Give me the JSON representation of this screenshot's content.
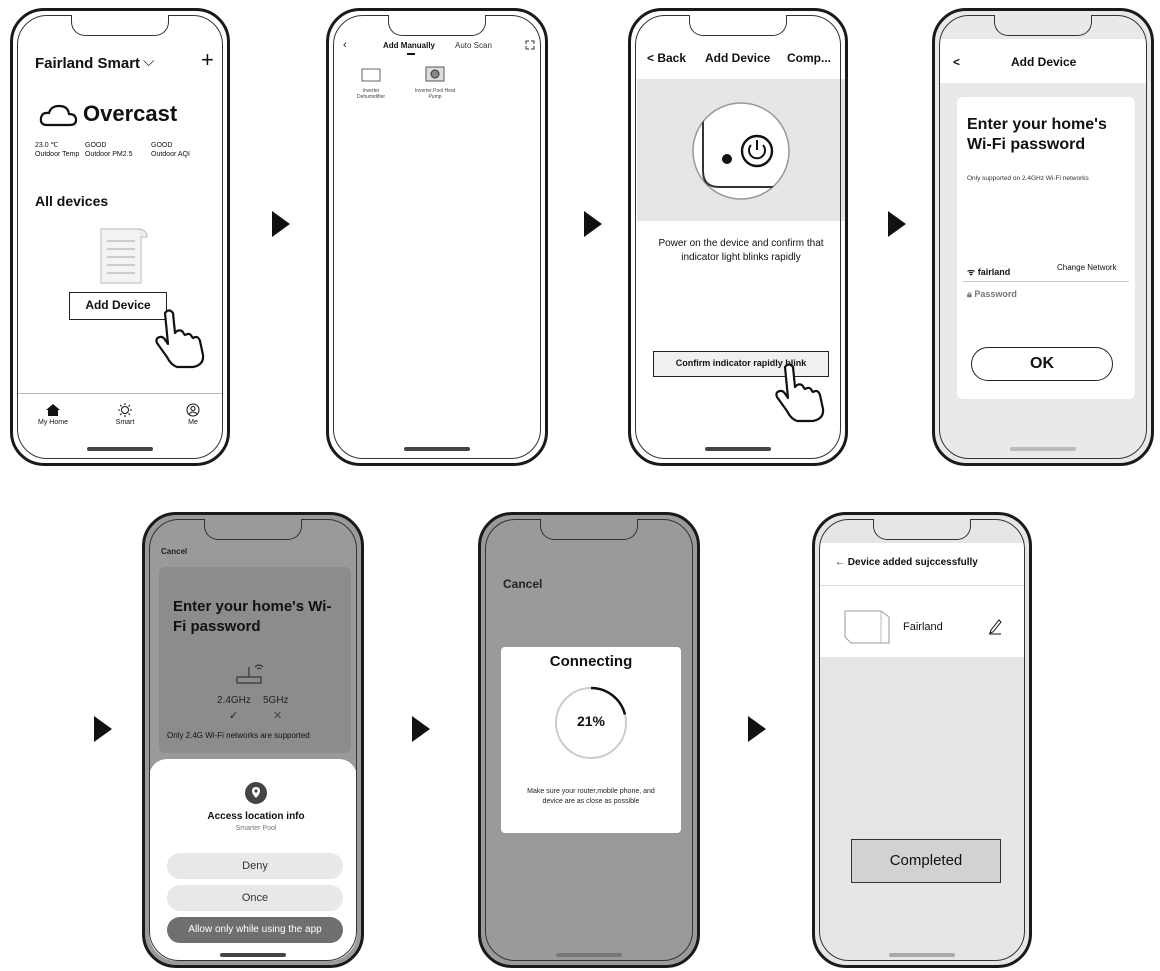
{
  "screen1": {
    "home_name": "Fairland Smart",
    "dropdown_glyph": "⌵",
    "add_glyph": "+",
    "weather": "Overcast",
    "stats": [
      {
        "value": "23.0 ℃",
        "label": "Outdoor Temp"
      },
      {
        "value": "GOOD",
        "label": "Outdoor PM2.5"
      },
      {
        "value": "GOOD",
        "label": "Outdoor AQI"
      }
    ],
    "section_title": "All devices",
    "add_device_button": "Add Device",
    "nav": [
      {
        "label": "My Home",
        "icon": "home-icon"
      },
      {
        "label": "Smart",
        "icon": "sun-icon"
      },
      {
        "label": "Me",
        "icon": "user-icon"
      }
    ]
  },
  "screen2": {
    "tab_manual": "Add Manually",
    "tab_scan": "Auto Scan",
    "devices": [
      {
        "label": "Inverter Dehumidifier"
      },
      {
        "label": "Inverter Pool Heat Pump"
      }
    ]
  },
  "screen3": {
    "back": "< Back",
    "title": "Add Device",
    "right": "Comp...",
    "instruction": "Power on the device and confirm that indicator light blinks rapidly",
    "confirm_button": "Confirm indicator rapidly blink"
  },
  "screen4": {
    "back": "<",
    "title": "Add Device",
    "heading": "Enter your home's Wi-Fi password",
    "note": "Only supported on 2.4GHz Wi-Fi networks",
    "network": "fairland",
    "change_network": "Change Network",
    "password_placeholder": "Password",
    "ok_button": "OK"
  },
  "screen5": {
    "cancel": "Cancel",
    "heading": "Enter your home's Wi-Fi password",
    "band_24": "2.4GHz",
    "band_5": "5GHz",
    "supported_note": "Only 2.4G Wi-Fi networks are supported",
    "sheet_title": "Access location info",
    "sheet_subtitle": "Smarter Pool",
    "options": [
      "Deny",
      "Once",
      "Allow only while using the app"
    ]
  },
  "screen6": {
    "cancel": "Cancel",
    "title": "Connecting",
    "progress_text": "21%",
    "progress": 0.21,
    "hint": "Make sure your router,mobile phone, and device are as close as possible"
  },
  "screen7": {
    "title": "Device added sujccessfully",
    "device_name": "Fairland",
    "completed_button": "Completed"
  },
  "colors": {
    "ink": "#111111",
    "overlay_grey": "#9a9a9a",
    "panel_grey": "#e6e6e6"
  }
}
